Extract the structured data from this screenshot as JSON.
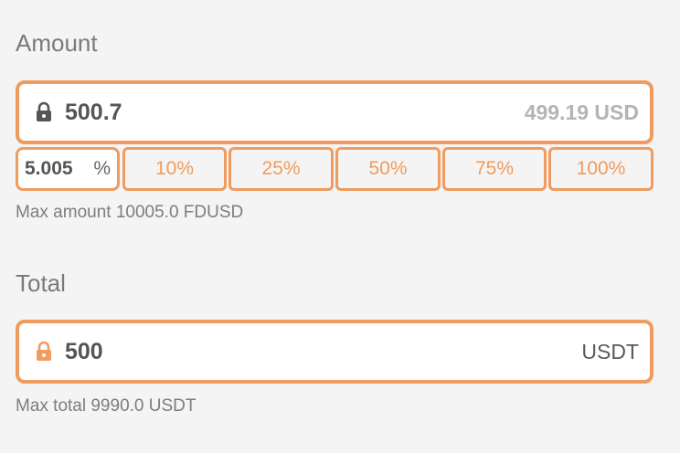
{
  "amount": {
    "label": "Amount",
    "value": "500.7",
    "converted": "499.19 USD",
    "percent_value": "5.005",
    "percent_symbol": "%",
    "quick_percents": [
      "10%",
      "25%",
      "50%",
      "75%",
      "100%"
    ],
    "max_text": "Max amount 10005.0 FDUSD",
    "lock_color": "#555555"
  },
  "total": {
    "label": "Total",
    "value": "500",
    "unit": "USDT",
    "max_text": "Max total 9990.0 USDT",
    "lock_color": "#ef9c5e"
  },
  "colors": {
    "accent": "#ef9c5e",
    "background": "#f4f4f4"
  },
  "icons": {
    "amount_lock": "lock-icon",
    "total_lock": "lock-icon"
  }
}
